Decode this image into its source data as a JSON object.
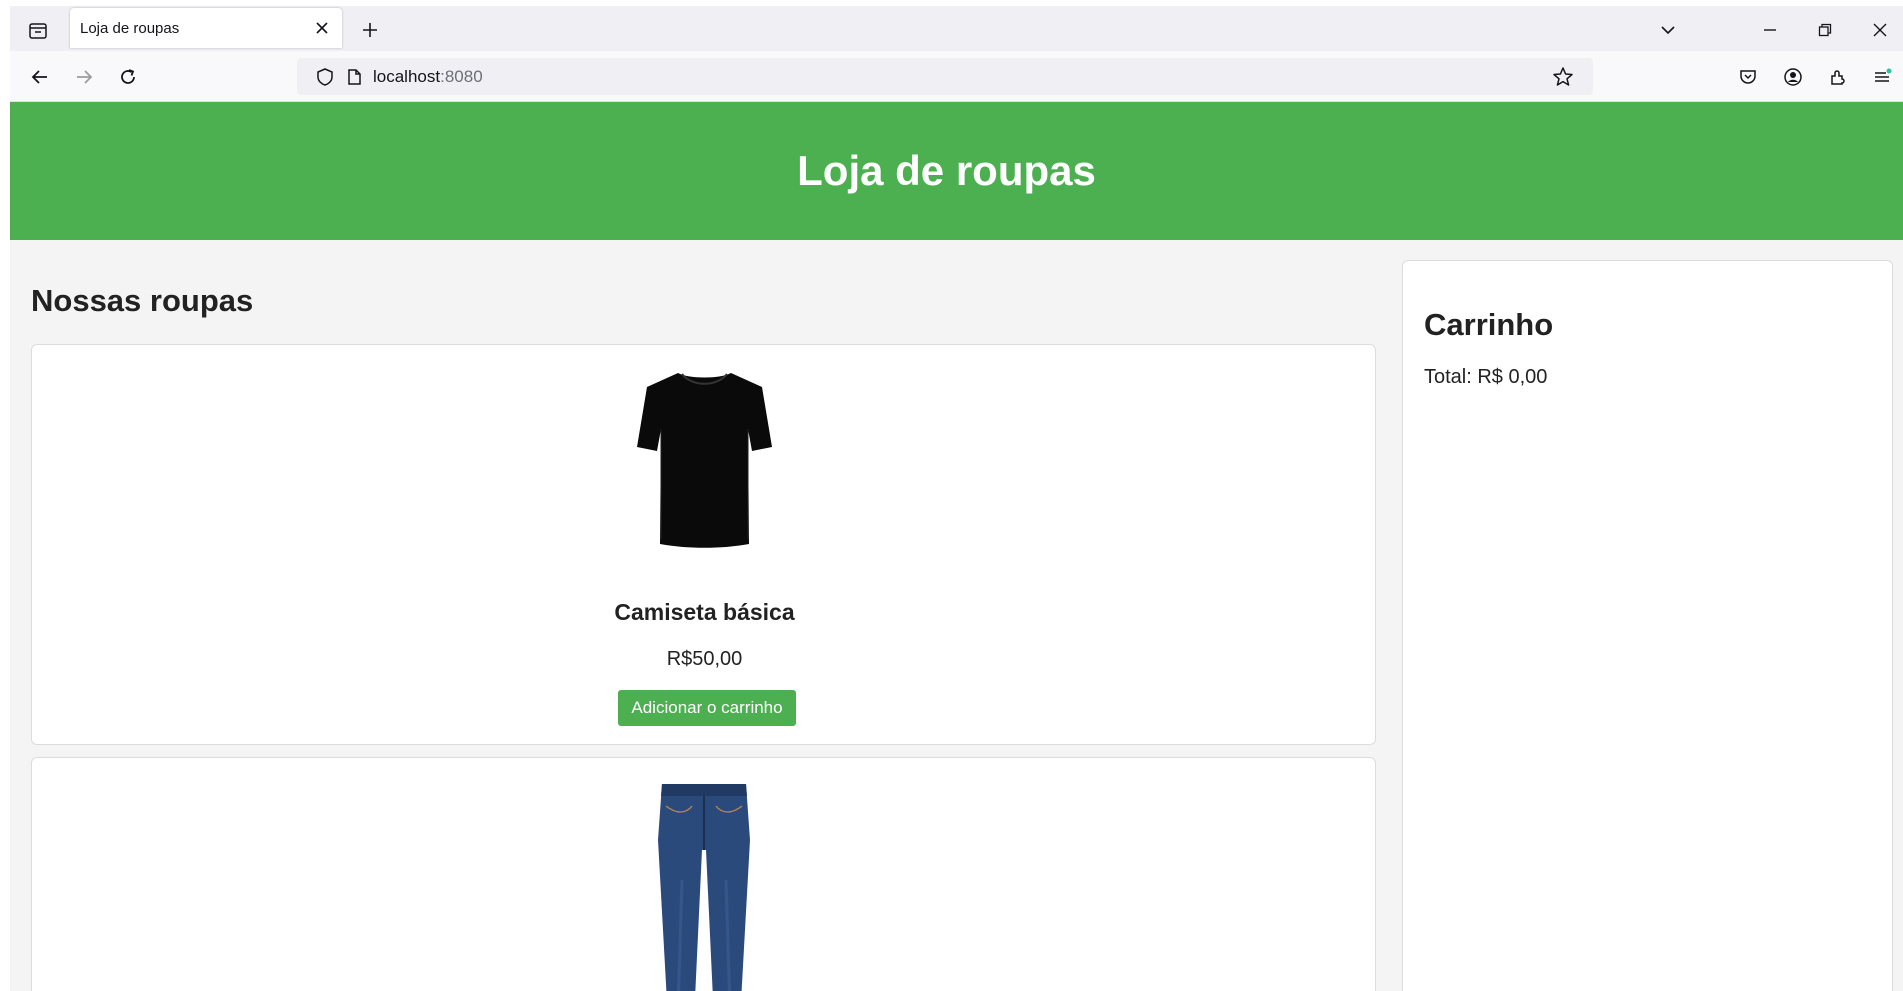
{
  "browser": {
    "tab_title": "Loja de roupas",
    "url_host": "localhost",
    "url_port": ":8080"
  },
  "site": {
    "title": "Loja de roupas"
  },
  "products": {
    "heading": "Nossas roupas",
    "items": [
      {
        "name": "Camiseta básica",
        "price": "R$50,00",
        "button": "Adicionar o carrinho",
        "image": "black-tshirt"
      },
      {
        "name": "",
        "price": "",
        "button": "",
        "image": "blue-jeans"
      }
    ]
  },
  "cart": {
    "title": "Carrinho",
    "total_label": "Total: ",
    "total_value": "R$ 0,00"
  },
  "colors": {
    "accent": "#4caf50",
    "page_bg": "#f4f4f4"
  }
}
